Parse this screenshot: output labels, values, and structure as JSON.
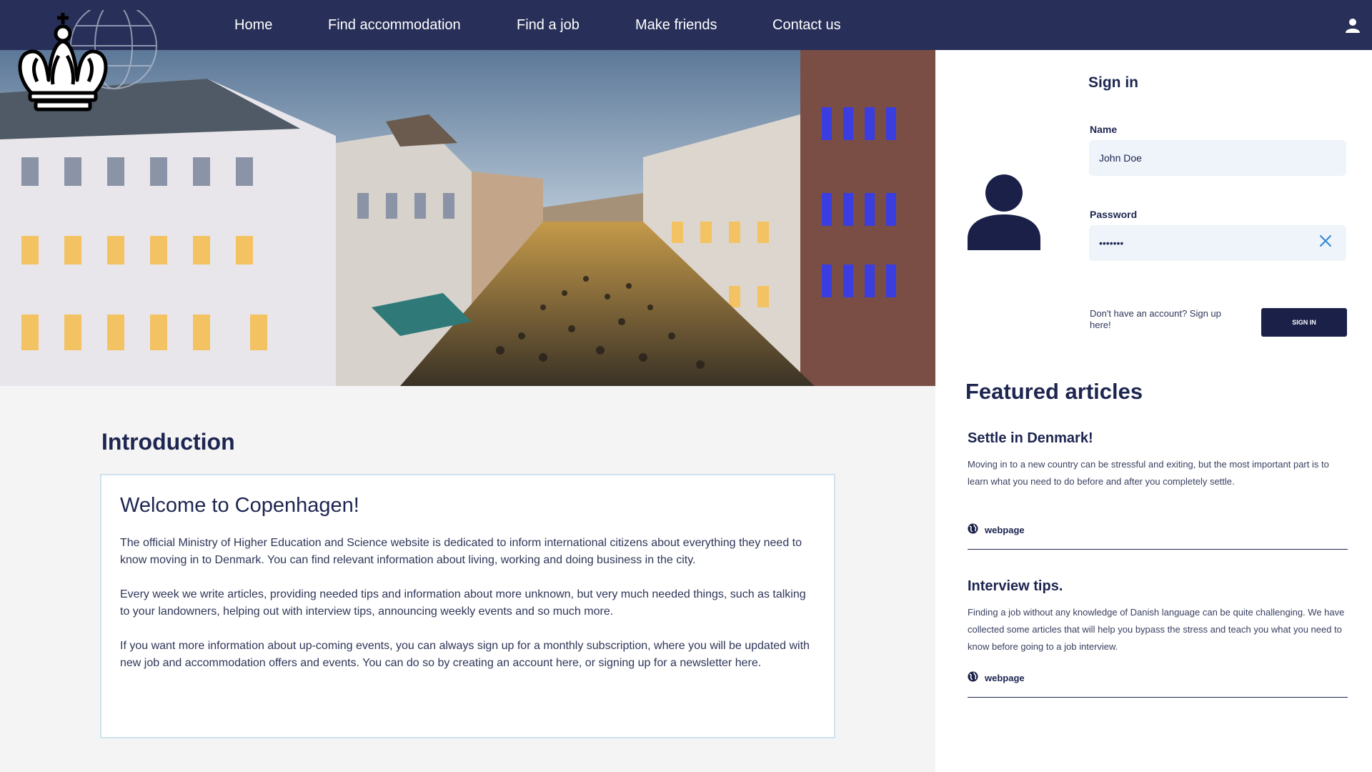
{
  "nav": {
    "items": [
      "Home",
      "Find accommodation",
      "Find a job",
      "Make friends",
      "Contact us"
    ]
  },
  "intro": {
    "heading": "Introduction",
    "welcome_title": "Welcome to Copenhagen!",
    "paragraphs": [
      "The official Ministry of Higher Education and Science website is dedicated to inform international citizens about everything they need to know moving in to Denmark. You can find relevant information about living, working and doing business in the city.",
      "Every week we write articles, providing needed tips and information about more unknown, but very much needed things, such as talking to your landowners, helping out with interview tips, announcing weekly events and so much more.",
      "If you want more information about up-coming events, you can always sign up for a monthly subscription, where you will be updated with new job and accommodation offers and events. You can do so by creating an account here, or signing up for a newsletter here."
    ]
  },
  "signin": {
    "title": "Sign in",
    "name_label": "Name",
    "name_value": "John Doe",
    "password_label": "Password",
    "password_value": "abc1234",
    "signup_prompt": "Don't have an account? Sign up here!",
    "button_label": "SIGN IN"
  },
  "featured": {
    "title": "Featured articles",
    "articles": [
      {
        "title": "Settle in Denmark!",
        "text": "Moving in to a new country can be stressful and exiting, but the most important part is to learn what you need to do before and after you completely settle.",
        "link_label": "webpage"
      },
      {
        "title": "Interview tips.",
        "text": "Finding a job without any knowledge of Danish language can be quite challenging. We have collected some articles that will help you bypass the stress and teach you what you need to know before going to a job interview.",
        "link_label": "webpage"
      }
    ]
  },
  "colors": {
    "nav_background": "#283059",
    "primary_dark": "#1a2048",
    "input_background": "#eef4f9",
    "accent_blue": "#2f86d8"
  },
  "icons": {
    "logo": "royal-crown-logo",
    "user": "user-icon",
    "avatar": "avatar-icon",
    "clear": "close-icon",
    "link": "globe-icon"
  }
}
